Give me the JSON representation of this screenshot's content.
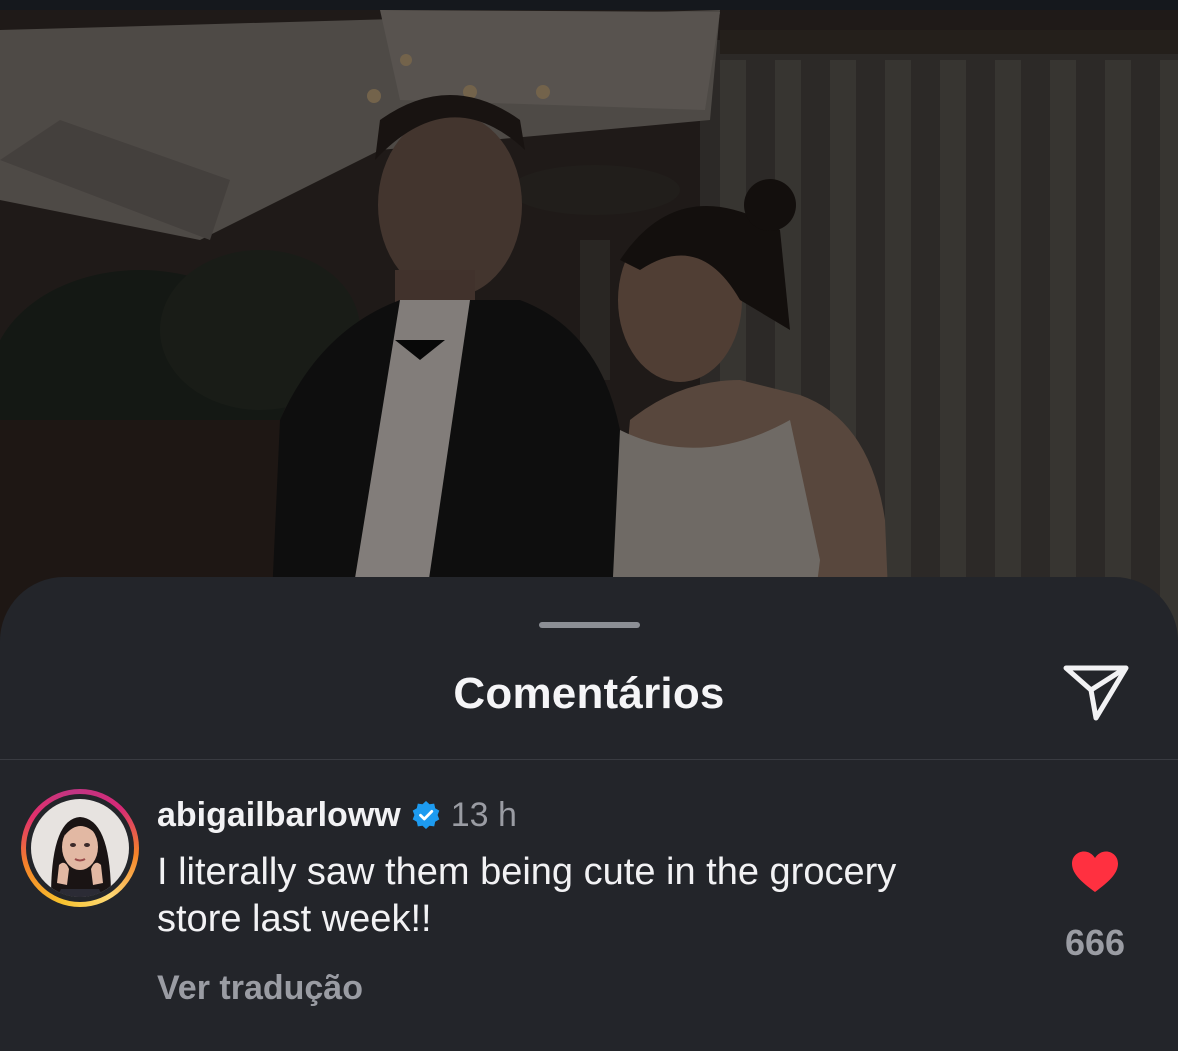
{
  "photo": {
    "description_icon": "post-photo-image"
  },
  "sheet": {
    "title": "Comentários",
    "share_icon": "paper-plane-icon"
  },
  "comment": {
    "username": "abigailbarloww",
    "verified_icon": "verified-badge-icon",
    "time": "13 h",
    "text": "I literally saw them being cute in the grocery store last week!!",
    "translate_label": "Ver tradução",
    "like_icon": "heart-filled-icon",
    "like_count": "666",
    "like_color": "#ff3040"
  },
  "colors": {
    "sheet_bg": "#23252a",
    "accent_verified": "#1d9bf0"
  }
}
